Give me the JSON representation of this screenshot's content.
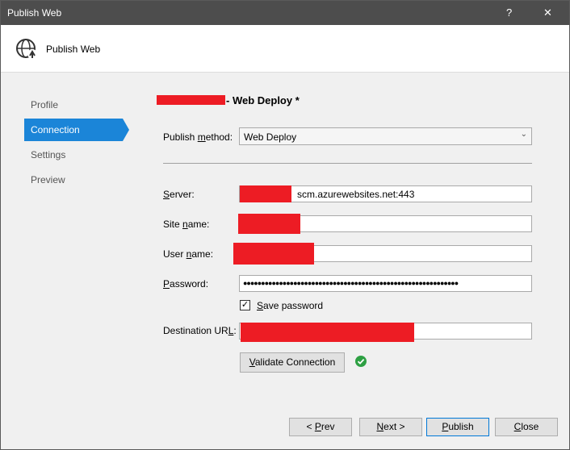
{
  "window": {
    "title": "Publish Web",
    "help_label": "?",
    "close_label": "✕"
  },
  "header": {
    "icon": "globe-publish-icon",
    "title": "Publish Web"
  },
  "nav": {
    "items": [
      "Profile",
      "Connection",
      "Settings",
      "Preview"
    ],
    "active": "Connection"
  },
  "profile": {
    "name_suffix": "- Web Deploy *"
  },
  "form": {
    "publish_method": {
      "label_pre": "Publish ",
      "label_u": "m",
      "label_post": "ethod:",
      "value": "Web Deploy"
    },
    "server": {
      "label_pre": "",
      "label_u": "S",
      "label_post": "erver:",
      "value_suffix": "scm.azurewebsites.net:443"
    },
    "site_name": {
      "label_pre": "Site ",
      "label_u": "n",
      "label_post": "ame:",
      "value": ""
    },
    "user_name": {
      "label_pre": "User ",
      "label_u": "n",
      "label_post": "ame:",
      "value": ""
    },
    "password": {
      "label_pre": "",
      "label_u": "P",
      "label_post": "assword:",
      "value": "●●●●●●●●●●●●●●●●●●●●●●●●●●●●●●●●●●●●●●●●●●●●●●●●●●●●●●●●●●●●"
    },
    "save_password": {
      "label_pre": "",
      "label_u": "S",
      "label_post": "ave password",
      "checked": true,
      "check_glyph": "✓"
    },
    "destination_url": {
      "label_pre": "Destination UR",
      "label_u": "L",
      "label_post": ":",
      "value": ""
    },
    "validate": {
      "label_pre": "",
      "label_u": "V",
      "label_post": "alidate Connection",
      "status_icon": "check-success-icon"
    }
  },
  "footer": {
    "prev": {
      "pre": "< ",
      "u": "P",
      "post": "rev"
    },
    "next": {
      "pre": "",
      "u": "N",
      "post": "ext >"
    },
    "publish": {
      "pre": "",
      "u": "P",
      "post": "ublish"
    },
    "close": {
      "pre": "",
      "u": "C",
      "post": "lose"
    }
  },
  "colors": {
    "accent": "#1b85d8",
    "titlebar": "#4d4d4d",
    "redaction": "#ed1c24",
    "success": "#2ea043"
  }
}
